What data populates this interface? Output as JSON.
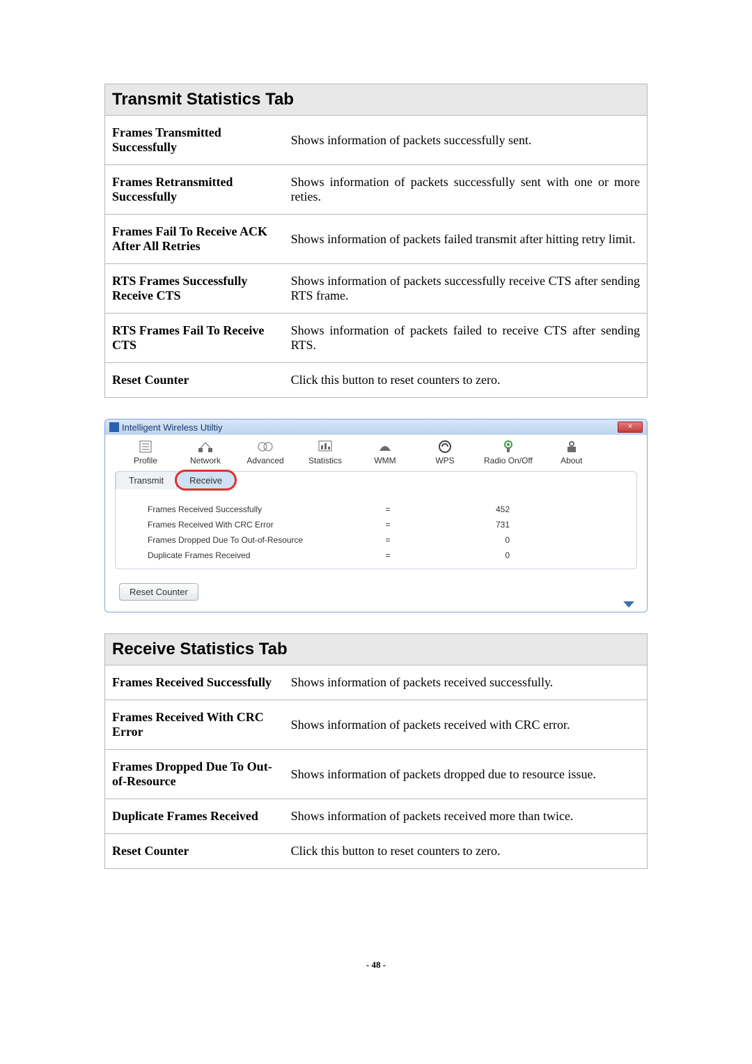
{
  "transmit_table": {
    "title": "Transmit Statistics Tab",
    "rows": [
      {
        "label": "Frames Transmitted Successfully",
        "desc": "Shows information of packets successfully sent."
      },
      {
        "label": "Frames Retransmitted Successfully",
        "desc": "Shows information of packets successfully sent with one or more reties."
      },
      {
        "label": "Frames Fail To Receive ACK After All Retries",
        "desc": "Shows information of packets failed transmit after hitting retry limit."
      },
      {
        "label": "RTS Frames Successfully Receive CTS",
        "desc": "Shows information of packets successfully receive CTS after sending RTS frame."
      },
      {
        "label": "RTS Frames Fail To Receive CTS",
        "desc": "Shows information of packets failed to receive CTS after sending RTS."
      },
      {
        "label": "Reset Counter",
        "desc": "Click this button to reset counters to zero."
      }
    ]
  },
  "dialog": {
    "title": "Intelligent Wireless Utiltiy",
    "close": "×",
    "toolbar": [
      {
        "name": "profile",
        "label": "Profile"
      },
      {
        "name": "network",
        "label": "Network"
      },
      {
        "name": "advanced",
        "label": "Advanced"
      },
      {
        "name": "statistics",
        "label": "Statistics"
      },
      {
        "name": "wmm",
        "label": "WMM"
      },
      {
        "name": "wps",
        "label": "WPS"
      },
      {
        "name": "radio",
        "label": "Radio On/Off"
      },
      {
        "name": "about",
        "label": "About"
      }
    ],
    "subtabs": {
      "transmit": "Transmit",
      "receive": "Receive"
    },
    "stats": [
      {
        "label": "Frames Received Successfully",
        "value": "452"
      },
      {
        "label": "Frames Received With CRC Error",
        "value": "731"
      },
      {
        "label": "Frames Dropped Due To Out-of-Resource",
        "value": "0"
      },
      {
        "label": "Duplicate Frames Received",
        "value": "0"
      }
    ],
    "eq": "=",
    "reset_label": "Reset Counter"
  },
  "receive_table": {
    "title": "Receive Statistics Tab",
    "rows": [
      {
        "label": "Frames Received Successfully",
        "desc": "Shows information of packets received successfully."
      },
      {
        "label": "Frames Received With CRC Error",
        "desc": "Shows information of packets received with CRC error."
      },
      {
        "label": "Frames Dropped Due To Out-of-Resource",
        "desc": "Shows information of packets dropped due to resource issue."
      },
      {
        "label": "Duplicate Frames Received",
        "desc": "Shows information of packets received more than twice."
      },
      {
        "label": "Reset Counter",
        "desc": "Click this button to reset counters to zero."
      }
    ]
  },
  "page_number": "- 48 -"
}
